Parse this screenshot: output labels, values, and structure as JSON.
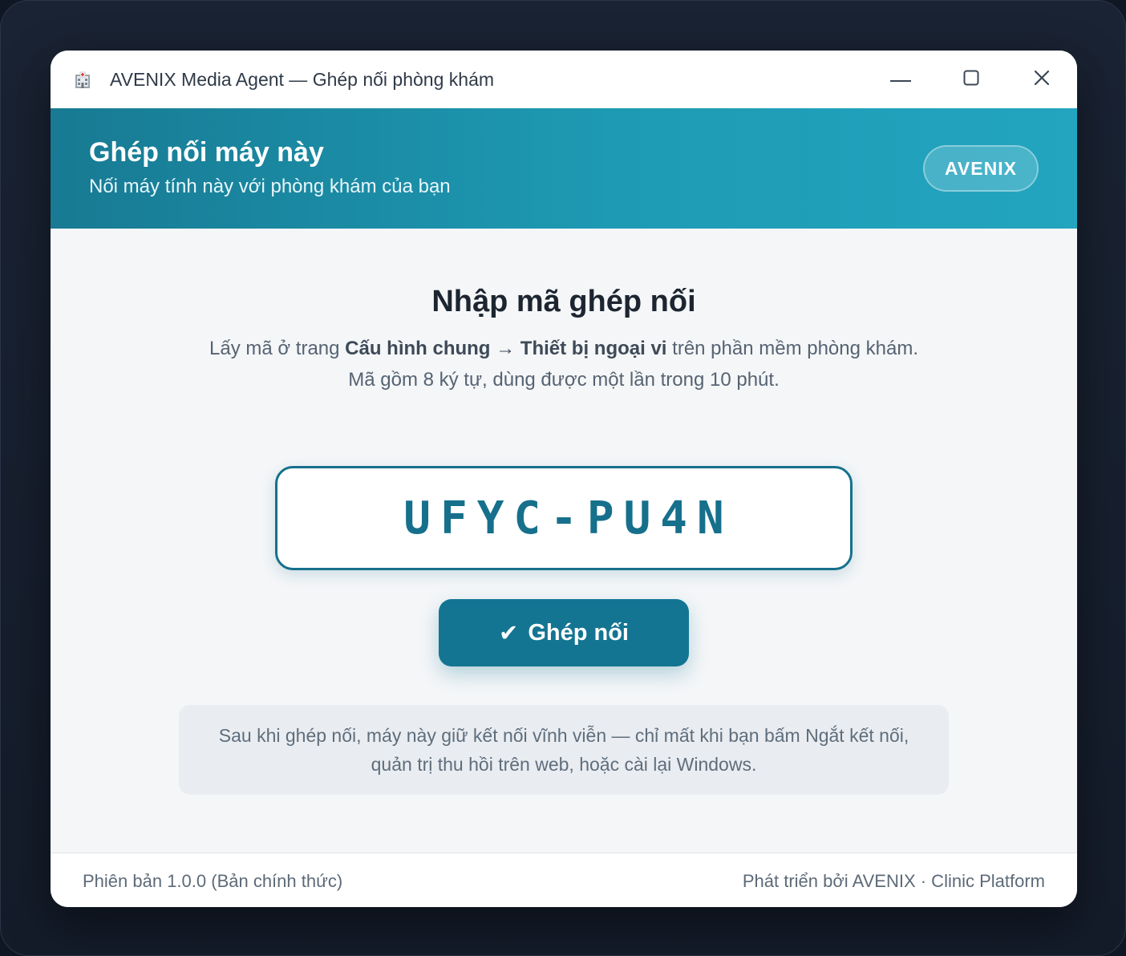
{
  "window": {
    "title": "AVENIX Media Agent — Ghép nối phòng khám",
    "icon": "clinic-building-icon"
  },
  "header": {
    "title": "Ghép nối máy này",
    "subtitle": "Nối máy tính này với phòng khám của bạn",
    "brand": "AVENIX",
    "gradient": [
      "#187a93",
      "#23a5bf"
    ]
  },
  "main": {
    "title": "Nhập mã ghép nối",
    "instruction_prefix": "Lấy mã ở trang ",
    "instruction_path": "Cấu hình chung → Thiết bị ngoại vi",
    "instruction_suffix": " trên phần mềm phòng khám.",
    "instruction_line2": "Mã gồm 8 ký tự, dùng được một lần trong 10 phút.",
    "code_value": "UFYC-PU4N",
    "pair_button_icon": "✔",
    "pair_button_label": "Ghép nối",
    "note": "Sau khi ghép nối, máy này giữ kết nối vĩnh viễn — chỉ mất khi bạn bấm Ngắt kết nối, quản trị thu hồi trên web, hoặc cài lại Windows."
  },
  "footer": {
    "version": "Phiên bản 1.0.0 (Bản chính thức)",
    "credit": "Phát triển bởi AVENIX · Clinic Platform"
  },
  "colors": {
    "accent": "#137592",
    "code_text": "#16708c"
  }
}
